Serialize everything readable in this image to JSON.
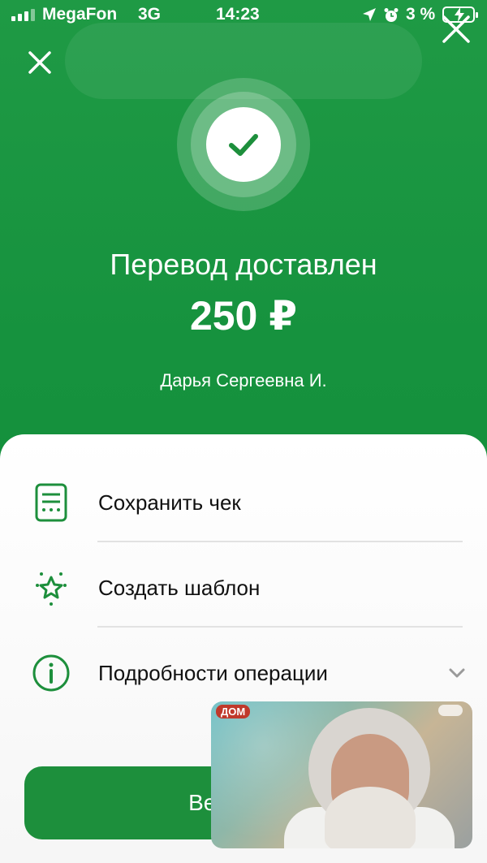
{
  "status_bar": {
    "carrier": "MegaFon",
    "network": "3G",
    "time": "14:23",
    "battery": "3 %",
    "icons": [
      "signal-icon",
      "location-icon",
      "alarm-icon",
      "battery-icon"
    ]
  },
  "result": {
    "title": "Перевод доставлен",
    "amount": "250 ₽",
    "recipient": "Дарья Сергеевна И."
  },
  "actions": [
    {
      "label": "Сохранить чек",
      "icon": "receipt-icon"
    },
    {
      "label": "Создать шаблон",
      "icon": "star-icon"
    },
    {
      "label": "Подробности операции",
      "icon": "info-icon"
    }
  ],
  "return_button": {
    "label": "Вернуться"
  },
  "video_overlay": {
    "channel_badge": "ДОМ"
  },
  "colors": {
    "brand_green": "#1d8f3c",
    "header_green": "#16923e",
    "sheet_bg": "#ffffff",
    "text_dark": "#111111"
  }
}
